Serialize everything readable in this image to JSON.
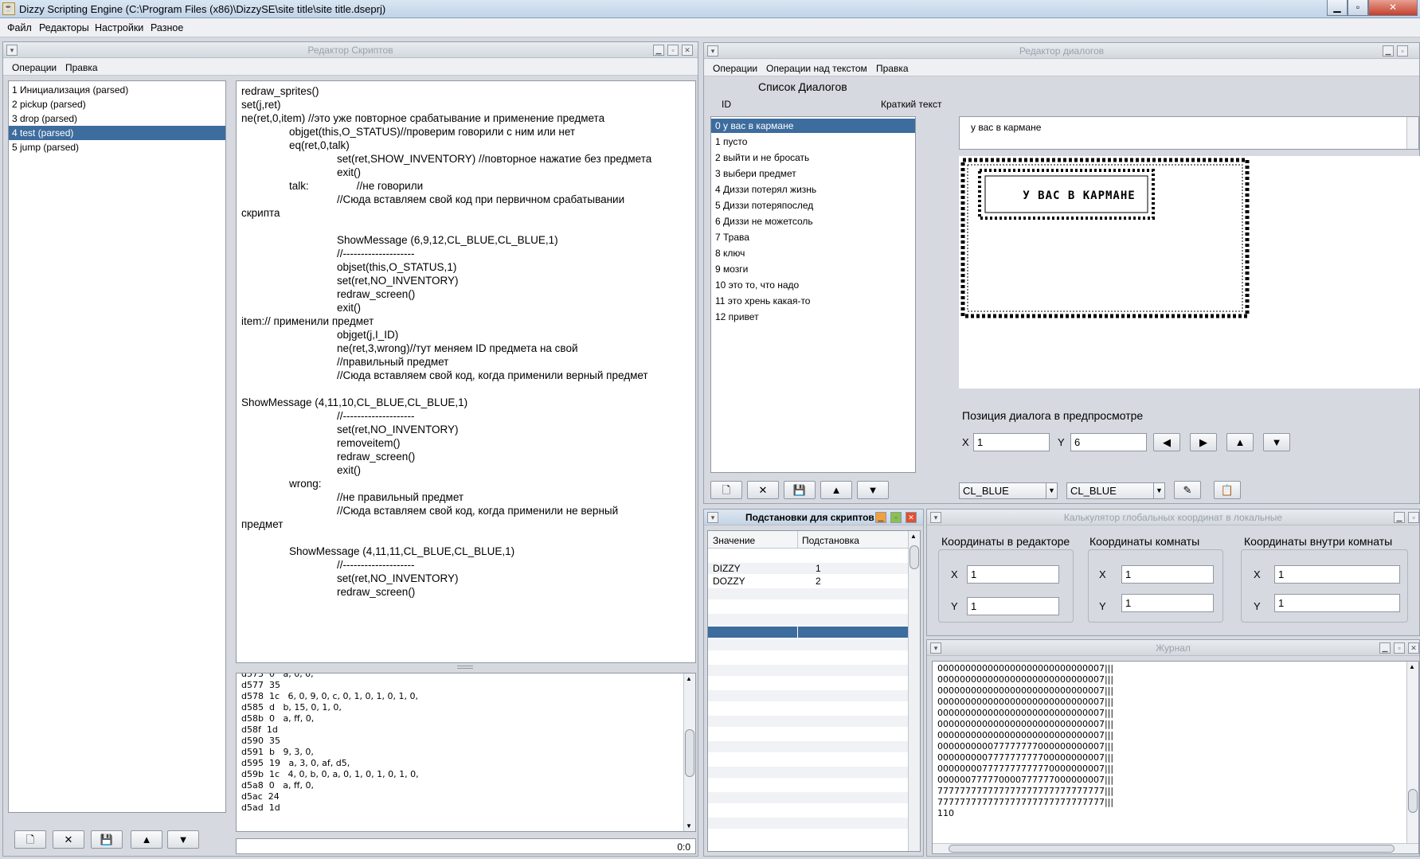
{
  "window": {
    "title": "Dizzy Scripting Engine (C:\\Program Files (x86)\\DizzySE\\site title\\site title.dseprj)"
  },
  "menu": [
    "Файл",
    "Редакторы",
    "Настройки",
    "Разное"
  ],
  "script_editor": {
    "title": "Редактор Скриптов",
    "menu": [
      "Операции",
      "Правка"
    ],
    "scripts": [
      "1 Инициализация  (parsed)",
      "2 pickup  (parsed)",
      "3 drop  (parsed)",
      "4 test  (parsed)",
      "5 jump  (parsed)"
    ],
    "selected_index": 3,
    "code": [
      "redraw_sprites()",
      "set(j,ret)",
      "ne(ret,0,item) //это уже повторное срабатывание и применение предмета",
      "\t\tobjget(this,O_STATUS)//проверим говорили с ним или нет",
      "\t\teq(ret,0,talk)",
      "\t\t\t\tset(ret,SHOW_INVENTORY) //повторное нажатие без предмета",
      "\t\t\t\texit()",
      "\t\ttalk:\t\t//не говорили",
      "\t\t\t\t//Сюда вставляем свой код при первичном срабатывании",
      "скрипта",
      "",
      "\t\t\t\tShowMessage (6,9,12,CL_BLUE,CL_BLUE,1)",
      "\t\t\t\t//--------------------",
      "\t\t\t\tobjset(this,O_STATUS,1)",
      "\t\t\t\tset(ret,NO_INVENTORY)",
      "\t\t\t\tredraw_screen()",
      "\t\t\t\texit()",
      "item:// применили предмет",
      "\t\t\t\tobjget(j,I_ID)",
      "\t\t\t\tne(ret,3,wrong)//тут меняем ID предмета на свой",
      "\t\t\t\t//правильный предмет",
      "\t\t\t\t//Сюда вставляем свой код, когда применили верный предмет",
      "",
      "ShowMessage (4,11,10,CL_BLUE,CL_BLUE,1)",
      "\t\t\t\t//--------------------",
      "\t\t\t\tset(ret,NO_INVENTORY)",
      "\t\t\t\tremoveitem()",
      "\t\t\t\tredraw_screen()",
      "\t\t\t\texit()",
      "\t\twrong:",
      "\t\t\t\t//не правильный предмет",
      "\t\t\t\t//Сюда вставляем свой код, когда применили не верный",
      "предмет",
      "",
      "\t\tShowMessage (4,11,11,CL_BLUE,CL_BLUE,1)",
      "\t\t\t\t//--------------------",
      "\t\t\t\tset(ret,NO_INVENTORY)",
      "\t\t\t\tredraw_screen()"
    ],
    "bytecode": [
      "d573  0   a, 0, 0,",
      "d577  35",
      "d578  1c   6, 0, 9, 0, c, 0, 1, 0, 1, 0, 1, 0,",
      "d585  d   b, 15, 0, 1, 0,",
      "d58b  0   a, ff, 0,",
      "d58f  1d",
      "d590  35",
      "d591  b   9, 3, 0,",
      "d595  19   a, 3, 0, af, d5,",
      "d59b  1c   4, 0, b, 0, a, 0, 1, 0, 1, 0, 1, 0,",
      "d5a8  0   a, ff, 0,",
      "d5ac  24",
      "d5ad  1d"
    ],
    "cursor_pos": "0:0"
  },
  "dialog_editor": {
    "title": "Редактор диалогов",
    "menu": [
      "Операции",
      "Операции над текстом",
      "Правка"
    ],
    "list_title": "Список Диалогов",
    "col_id": "ID",
    "col_short": "Краткий текст",
    "dialogs": [
      "0 у вас в кармане",
      "1 пусто",
      "2 выйти и не бросать",
      "3 выбери предмет",
      "4 Диззи потерял жизнь",
      "5 Диззи потеряпослед",
      "6 Диззи не можетсоль",
      "7 Трава",
      "8 ключ",
      "9 мозги",
      "10 это то, что надо",
      "11 это хрень какая-то",
      "12 привет"
    ],
    "selected_index": 0,
    "text_value": "у вас в кармане",
    "preview_text": "У ВАС В КАРМАНЕ",
    "position_label": "Позиция диалога в предпросмотре",
    "x_label": "X",
    "x_value": "1",
    "y_label": "Y",
    "y_value": "6",
    "color1": "CL_BLUE",
    "color2": "CL_BLUE"
  },
  "substitutions": {
    "title": "Подстановки для скриптов",
    "col_value": "Значение",
    "col_subst": "Подстановка",
    "rows": [
      {
        "value": "DIZZY",
        "subst": "1"
      },
      {
        "value": "DOZZY",
        "subst": "2"
      }
    ]
  },
  "calculator": {
    "title": "Калькулятор глобальных координат в локальные",
    "groups": [
      {
        "title": "Координаты в редакторе",
        "x": "1",
        "y": "1"
      },
      {
        "title": "Координаты комнаты",
        "x": "1",
        "y": "1"
      },
      {
        "title": "Координаты внутри комнаты",
        "x": "1",
        "y": "1"
      }
    ],
    "x_label": "X",
    "y_label": "Y"
  },
  "journal": {
    "title": "Журнал",
    "lines": [
      "000000000000000000000000000007|||",
      "000000000000000000000000000007|||",
      "000000000000000000000000000007|||",
      "000000000000000000000000000007|||",
      "000000000000000000000000000007|||",
      "000000000000000000000000000007|||",
      "000000000000000000000000000007|||",
      "000000000077777777000000000007|||",
      "000000000777777777700000000007|||",
      "000000007777777777770000000007|||",
      "000000777770000777777000000007|||",
      "777777777777777777777777777777|||",
      "777777777777777777777777777777|||",
      "110"
    ]
  },
  "icons": [
    "new-icon",
    "delete-icon",
    "save-icon",
    "up-icon",
    "down-icon",
    "left-icon",
    "right-icon",
    "edit-icon",
    "clipboard-icon"
  ]
}
